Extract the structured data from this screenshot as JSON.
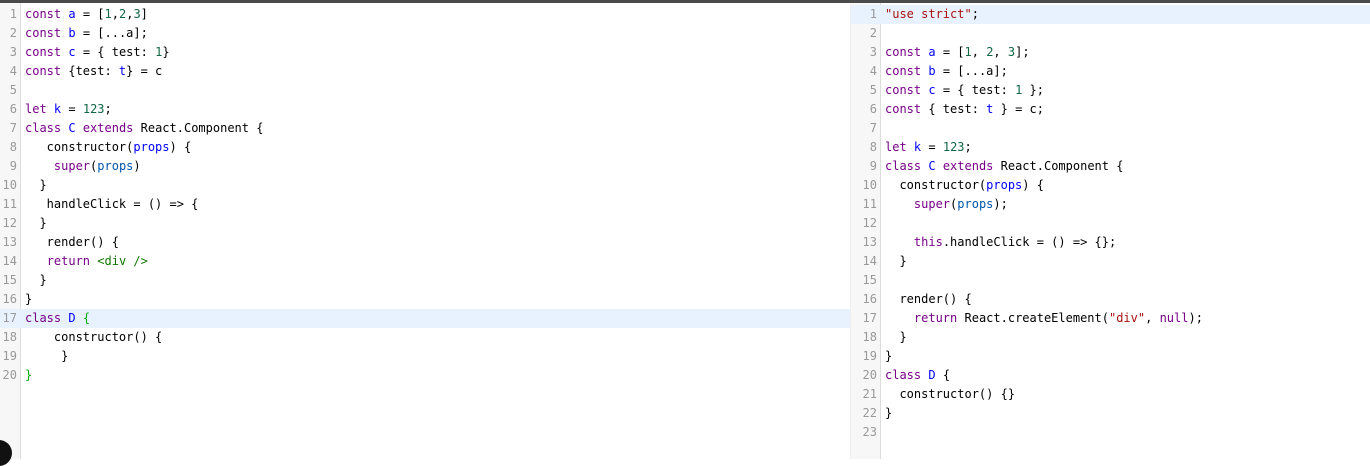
{
  "colors": {
    "keyword": "#770088",
    "definition": "#0000ff",
    "number": "#116644",
    "string": "#aa1111",
    "variable_2": "#0055aa",
    "tag": "#117700",
    "matching_bracket": "#00aa00",
    "active_line": "#e8f2ff",
    "gutter": "#f7f7f7",
    "line_number": "#999999"
  },
  "source_editor": {
    "active_line": 17,
    "lines": [
      {
        "n": "1",
        "tokens": [
          {
            "t": "const",
            "c": "kw"
          },
          {
            "t": " "
          },
          {
            "t": "a",
            "c": "def"
          },
          {
            "t": " = ["
          },
          {
            "t": "1",
            "c": "num"
          },
          {
            "t": ","
          },
          {
            "t": "2",
            "c": "num"
          },
          {
            "t": ","
          },
          {
            "t": "3",
            "c": "num"
          },
          {
            "t": "]"
          }
        ]
      },
      {
        "n": "2",
        "tokens": [
          {
            "t": "const",
            "c": "kw"
          },
          {
            "t": " "
          },
          {
            "t": "b",
            "c": "def"
          },
          {
            "t": " = [..."
          },
          {
            "t": "a"
          },
          {
            "t": "];"
          }
        ]
      },
      {
        "n": "3",
        "tokens": [
          {
            "t": "const",
            "c": "kw"
          },
          {
            "t": " "
          },
          {
            "t": "c",
            "c": "def"
          },
          {
            "t": " = { test: "
          },
          {
            "t": "1",
            "c": "num"
          },
          {
            "t": "}"
          }
        ]
      },
      {
        "n": "4",
        "tokens": [
          {
            "t": "const",
            "c": "kw"
          },
          {
            "t": " {test: "
          },
          {
            "t": "t",
            "c": "def"
          },
          {
            "t": "} = c"
          }
        ]
      },
      {
        "n": "5",
        "tokens": []
      },
      {
        "n": "6",
        "tokens": [
          {
            "t": "let",
            "c": "kw"
          },
          {
            "t": " "
          },
          {
            "t": "k",
            "c": "def"
          },
          {
            "t": " = "
          },
          {
            "t": "123",
            "c": "num"
          },
          {
            "t": ";"
          }
        ]
      },
      {
        "n": "7",
        "tokens": [
          {
            "t": "class",
            "c": "kw"
          },
          {
            "t": " "
          },
          {
            "t": "C",
            "c": "def"
          },
          {
            "t": " "
          },
          {
            "t": "extends",
            "c": "kw"
          },
          {
            "t": " React.Component {"
          }
        ]
      },
      {
        "n": "8",
        "tokens": [
          {
            "t": "   constructor("
          },
          {
            "t": "props",
            "c": "def"
          },
          {
            "t": ") {"
          }
        ]
      },
      {
        "n": "9",
        "tokens": [
          {
            "t": "    "
          },
          {
            "t": "super",
            "c": "kw"
          },
          {
            "t": "("
          },
          {
            "t": "props",
            "c": "vr2"
          },
          {
            "t": ")"
          }
        ]
      },
      {
        "n": "10",
        "tokens": [
          {
            "t": "  }"
          }
        ]
      },
      {
        "n": "11",
        "tokens": [
          {
            "t": "   handleClick = () => {"
          }
        ]
      },
      {
        "n": "12",
        "tokens": [
          {
            "t": "  }"
          }
        ]
      },
      {
        "n": "13",
        "tokens": [
          {
            "t": "   render() {"
          }
        ]
      },
      {
        "n": "14",
        "tokens": [
          {
            "t": "   "
          },
          {
            "t": "return",
            "c": "kw"
          },
          {
            "t": " "
          },
          {
            "t": "<div />",
            "c": "tag"
          }
        ]
      },
      {
        "n": "15",
        "tokens": [
          {
            "t": "  }"
          }
        ]
      },
      {
        "n": "16",
        "tokens": [
          {
            "t": "}"
          }
        ]
      },
      {
        "n": "17",
        "tokens": [
          {
            "t": "class",
            "c": "kw"
          },
          {
            "t": " "
          },
          {
            "t": "D",
            "c": "def"
          },
          {
            "t": " "
          },
          {
            "t": "{",
            "c": "brm"
          }
        ]
      },
      {
        "n": "18",
        "tokens": [
          {
            "t": "    constructor() {"
          }
        ]
      },
      {
        "n": "19",
        "tokens": [
          {
            "t": "     }"
          }
        ]
      },
      {
        "n": "20",
        "tokens": [
          {
            "t": "}",
            "c": "brm"
          }
        ]
      }
    ]
  },
  "output_editor": {
    "active_line": 1,
    "lines": [
      {
        "n": "1",
        "tokens": [
          {
            "t": "\"use strict\"",
            "c": "str"
          },
          {
            "t": ";"
          }
        ]
      },
      {
        "n": "2",
        "tokens": []
      },
      {
        "n": "3",
        "tokens": [
          {
            "t": "const",
            "c": "kw"
          },
          {
            "t": " "
          },
          {
            "t": "a",
            "c": "def"
          },
          {
            "t": " = ["
          },
          {
            "t": "1",
            "c": "num"
          },
          {
            "t": ", "
          },
          {
            "t": "2",
            "c": "num"
          },
          {
            "t": ", "
          },
          {
            "t": "3",
            "c": "num"
          },
          {
            "t": "];"
          }
        ]
      },
      {
        "n": "4",
        "tokens": [
          {
            "t": "const",
            "c": "kw"
          },
          {
            "t": " "
          },
          {
            "t": "b",
            "c": "def"
          },
          {
            "t": " = [..."
          },
          {
            "t": "a"
          },
          {
            "t": "];"
          }
        ]
      },
      {
        "n": "5",
        "tokens": [
          {
            "t": "const",
            "c": "kw"
          },
          {
            "t": " "
          },
          {
            "t": "c",
            "c": "def"
          },
          {
            "t": " = { test: "
          },
          {
            "t": "1",
            "c": "num"
          },
          {
            "t": " };"
          }
        ]
      },
      {
        "n": "6",
        "tokens": [
          {
            "t": "const",
            "c": "kw"
          },
          {
            "t": " { test: "
          },
          {
            "t": "t",
            "c": "def"
          },
          {
            "t": " } = c;"
          }
        ]
      },
      {
        "n": "7",
        "tokens": []
      },
      {
        "n": "8",
        "tokens": [
          {
            "t": "let",
            "c": "kw"
          },
          {
            "t": " "
          },
          {
            "t": "k",
            "c": "def"
          },
          {
            "t": " = "
          },
          {
            "t": "123",
            "c": "num"
          },
          {
            "t": ";"
          }
        ]
      },
      {
        "n": "9",
        "tokens": [
          {
            "t": "class",
            "c": "kw"
          },
          {
            "t": " "
          },
          {
            "t": "C",
            "c": "def"
          },
          {
            "t": " "
          },
          {
            "t": "extends",
            "c": "kw"
          },
          {
            "t": " React.Component {"
          }
        ]
      },
      {
        "n": "10",
        "tokens": [
          {
            "t": "  constructor("
          },
          {
            "t": "props",
            "c": "def"
          },
          {
            "t": ") {"
          }
        ]
      },
      {
        "n": "11",
        "tokens": [
          {
            "t": "    "
          },
          {
            "t": "super",
            "c": "kw"
          },
          {
            "t": "("
          },
          {
            "t": "props",
            "c": "vr2"
          },
          {
            "t": ");"
          }
        ]
      },
      {
        "n": "12",
        "tokens": []
      },
      {
        "n": "13",
        "tokens": [
          {
            "t": "    "
          },
          {
            "t": "this",
            "c": "kw"
          },
          {
            "t": ".handleClick = () => {};"
          }
        ]
      },
      {
        "n": "14",
        "tokens": [
          {
            "t": "  }"
          }
        ]
      },
      {
        "n": "15",
        "tokens": []
      },
      {
        "n": "16",
        "tokens": [
          {
            "t": "  render() {"
          }
        ]
      },
      {
        "n": "17",
        "tokens": [
          {
            "t": "    "
          },
          {
            "t": "return",
            "c": "kw"
          },
          {
            "t": " React.createElement("
          },
          {
            "t": "\"div\"",
            "c": "str"
          },
          {
            "t": ", "
          },
          {
            "t": "null",
            "c": "kw"
          },
          {
            "t": ");"
          }
        ]
      },
      {
        "n": "18",
        "tokens": [
          {
            "t": "  }"
          }
        ]
      },
      {
        "n": "19",
        "tokens": [
          {
            "t": "}"
          }
        ]
      },
      {
        "n": "20",
        "tokens": [
          {
            "t": "class",
            "c": "kw"
          },
          {
            "t": " "
          },
          {
            "t": "D",
            "c": "def"
          },
          {
            "t": " {"
          }
        ]
      },
      {
        "n": "21",
        "tokens": [
          {
            "t": "  constructor() {}"
          }
        ]
      },
      {
        "n": "22",
        "tokens": [
          {
            "t": "}"
          }
        ]
      },
      {
        "n": "23",
        "tokens": []
      }
    ]
  }
}
